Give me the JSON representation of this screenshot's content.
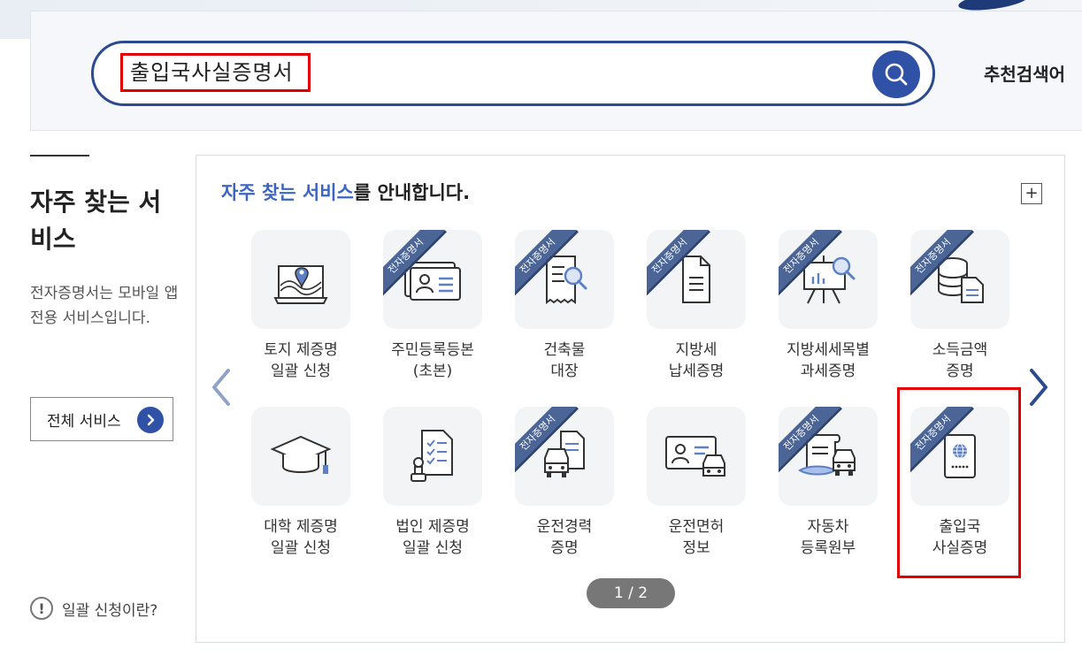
{
  "search": {
    "query": "출입국사실증명서",
    "recommend_label": "추천검색어"
  },
  "sidebar": {
    "title": "자주 찾는 서비스",
    "description": "전자증명서는 모바일 앱 전용 서비스입니다.",
    "all_services_label": "전체 서비스",
    "batch_help_label": "일괄 신청이란?"
  },
  "panel": {
    "title_highlight": "자주 찾는 서비스",
    "title_rest": "를 안내합니다.",
    "plus_label": "+",
    "pager": "1 / 2",
    "ribbon_label": "전자증명서",
    "services": [
      {
        "line1": "토지 제증명",
        "line2": "일괄 신청",
        "ribbon": false,
        "icon": "land-map-icon"
      },
      {
        "line1": "주민등록등본",
        "line2": "(초본)",
        "ribbon": true,
        "icon": "id-card-icon"
      },
      {
        "line1": "건축물",
        "line2": "대장",
        "ribbon": true,
        "icon": "building-register-icon"
      },
      {
        "line1": "지방세",
        "line2": "납세증명",
        "ribbon": true,
        "icon": "document-icon"
      },
      {
        "line1": "지방세세목별",
        "line2": "과세증명",
        "ribbon": true,
        "icon": "presentation-board-icon"
      },
      {
        "line1": "소득금액",
        "line2": "증명",
        "ribbon": true,
        "icon": "database-document-icon"
      },
      {
        "line1": "대학 제증명",
        "line2": "일괄 신청",
        "ribbon": false,
        "icon": "graduation-cap-icon"
      },
      {
        "line1": "법인 제증명",
        "line2": "일괄 신청",
        "ribbon": false,
        "icon": "stamp-checklist-icon"
      },
      {
        "line1": "운전경력",
        "line2": "증명",
        "ribbon": true,
        "icon": "car-document-icon"
      },
      {
        "line1": "운전면허",
        "line2": "정보",
        "ribbon": false,
        "icon": "license-car-icon"
      },
      {
        "line1": "자동차",
        "line2": "등록원부",
        "ribbon": true,
        "icon": "car-scroll-icon"
      },
      {
        "line1": "출입국",
        "line2": "사실증명",
        "ribbon": true,
        "icon": "passport-icon"
      }
    ]
  },
  "colors": {
    "accent": "#2f52a6",
    "highlight_text": "#3b64c4",
    "annotation": "#e00000",
    "ribbon": "#4a6596"
  }
}
